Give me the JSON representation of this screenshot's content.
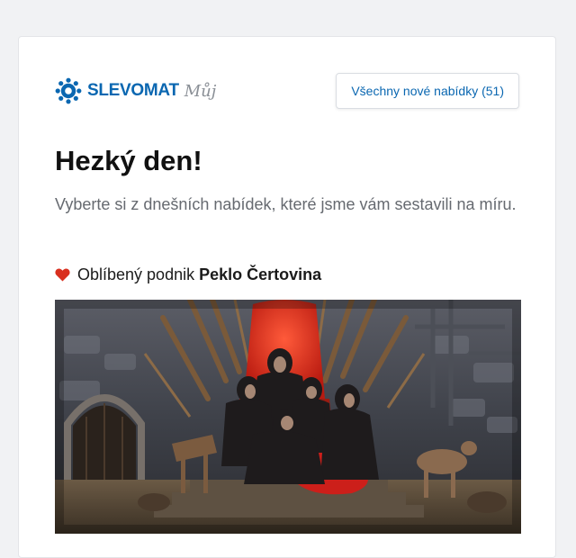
{
  "header": {
    "logo_text": "SLEVOMAT",
    "logo_sub": "Můj",
    "all_offers_label": "Všechny nové nabídky (51)"
  },
  "main": {
    "headline": "Hezký den!",
    "subline": "Vyberte si z dnešních nabídek, které jsme vám sestavili na míru.",
    "favorite": {
      "prefix": "Oblíbený podnik",
      "name": "Peklo Čertovina"
    }
  },
  "colors": {
    "brand_blue": "#0a67b1",
    "heart_red": "#d9301f",
    "background": "#f1f2f4"
  },
  "icons": {
    "logo": "gear-icon",
    "favorite": "heart-icon"
  }
}
